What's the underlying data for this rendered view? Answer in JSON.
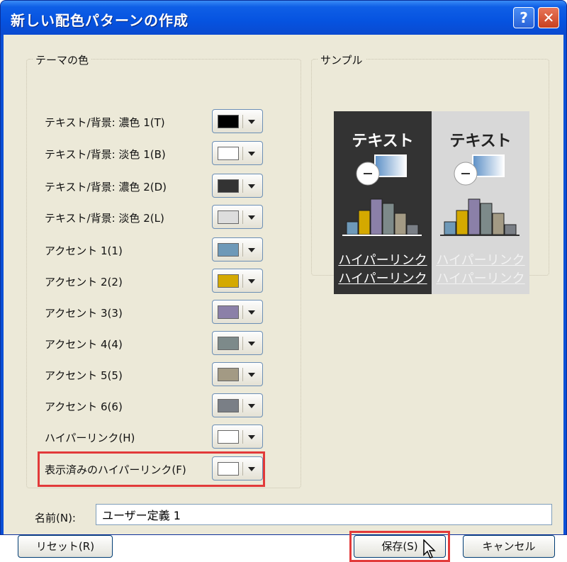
{
  "window": {
    "title": "新しい配色パターンの作成",
    "help_glyph": "?",
    "close_glyph": "✕"
  },
  "theme_colors": {
    "group_title": "テーマの色",
    "rows": [
      {
        "label": "テキスト/背景: 濃色 1(T)",
        "color": "#000000"
      },
      {
        "label": "テキスト/背景: 淡色 1(B)",
        "color": "#ffffff"
      },
      {
        "label": "テキスト/背景: 濃色 2(D)",
        "color": "#333333"
      },
      {
        "label": "テキスト/背景: 淡色 2(L)",
        "color": "#dddddd"
      },
      {
        "label": "アクセント 1(1)",
        "color": "#6e99b8"
      },
      {
        "label": "アクセント 2(2)",
        "color": "#d4a900"
      },
      {
        "label": "アクセント 3(3)",
        "color": "#8b80a8"
      },
      {
        "label": "アクセント 4(4)",
        "color": "#7d8a8a"
      },
      {
        "label": "アクセント 5(5)",
        "color": "#a39a84"
      },
      {
        "label": "アクセント 6(6)",
        "color": "#7a7f86"
      },
      {
        "label": "ハイパーリンク(H)",
        "color": "#ffffff"
      },
      {
        "label": "表示済みのハイパーリンク(F)",
        "color": "#ffffff"
      }
    ]
  },
  "sample": {
    "group_title": "サンプル",
    "dark_text": "テキスト",
    "light_text": "テキスト",
    "link_1": "ハイパーリンク",
    "link_2": "ハイパーリンク",
    "dark_bg": "#333333",
    "light_bg": "#d8d8d8"
  },
  "name_field": {
    "label": "名前(N):",
    "value": "ユーザー定義 1"
  },
  "buttons": {
    "reset": "リセット(R)",
    "save": "保存(S)",
    "cancel": "キャンセル"
  },
  "colors": {
    "highlight": "#e23a3a",
    "titlebar": "#0653e0"
  }
}
